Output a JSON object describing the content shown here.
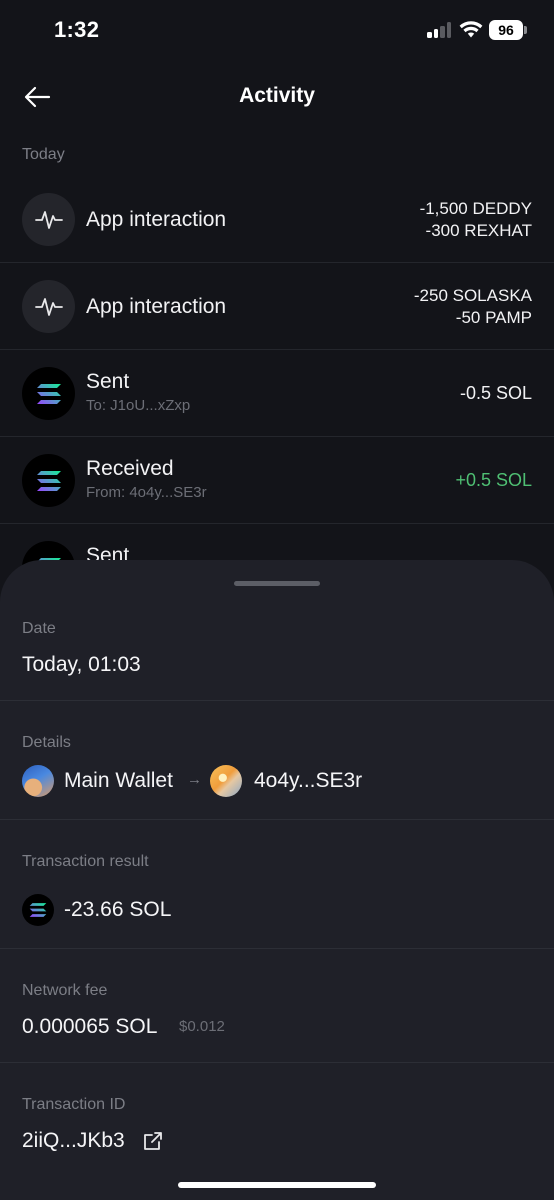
{
  "status_bar": {
    "time": "1:32",
    "battery": "96"
  },
  "header": {
    "title": "Activity"
  },
  "section": {
    "today_label": "Today"
  },
  "activity": [
    {
      "title": "App interaction",
      "amount_line1": "-1,500 DEDDY",
      "amount_line2": "-300 REXHAT",
      "icon": "activity-pulse-icon"
    },
    {
      "title": "App interaction",
      "amount_line1": "-250 SOLASKA",
      "amount_line2": "-50 PAMP",
      "icon": "activity-pulse-icon"
    },
    {
      "title": "Sent",
      "subtitle": "To: J1oU...xZxp",
      "amount": "-0.5 SOL",
      "icon": "solana-icon"
    },
    {
      "title": "Received",
      "subtitle": "From: 4o4y...SE3r",
      "amount": "+0.5 SOL",
      "icon": "solana-icon",
      "positive_color": "#4fbf73"
    },
    {
      "title": "Sent",
      "icon": "solana-icon"
    }
  ],
  "sheet": {
    "date": {
      "label": "Date",
      "value": "Today, 01:03"
    },
    "details": {
      "label": "Details",
      "from": "Main Wallet",
      "to": "4o4y...SE3r"
    },
    "result": {
      "label": "Transaction result",
      "value": "-23.66 SOL"
    },
    "fee": {
      "label": "Network fee",
      "value": "0.000065 SOL",
      "usd": "$0.012"
    },
    "txid": {
      "label": "Transaction ID",
      "value": "2iiQ...JKb3"
    }
  },
  "colors": {
    "background": "#131419",
    "sheet": "#1f2028",
    "positive": "#4fbf73",
    "muted": "#7c7e86"
  }
}
